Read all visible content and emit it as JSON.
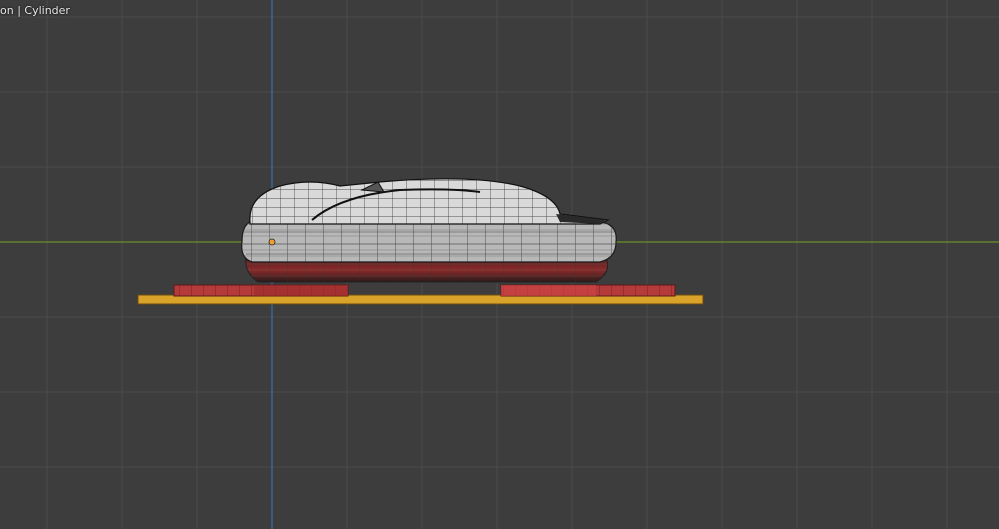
{
  "viewport": {
    "header_text": "on | Cylinder",
    "background_color": "#3d3d3d",
    "grid_color": "#4a4a4a",
    "x_axis_color": "#6a8f2a",
    "z_axis_color": "#3a6fb0"
  },
  "scene": {
    "mesh_fill_color": "#d9d9d9",
    "wire_color": "#1a1a1a",
    "rim_color": "#b8b8b8",
    "lower_rim_color": "#7a2a2a",
    "pad_color": "#b53a3a",
    "base_plate_color": "#d9a32a",
    "origin_color": "#f0a030"
  }
}
